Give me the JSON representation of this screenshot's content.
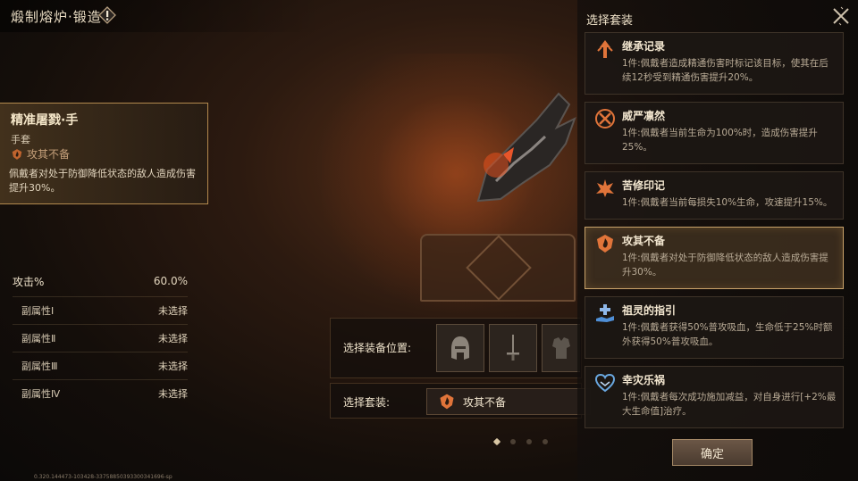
{
  "header": {
    "title": "煅制熔炉·锻造"
  },
  "item": {
    "name": "精准屠戮·手",
    "type": "手套",
    "set_name": "攻其不备",
    "description": "佩戴者对处于防御降低状态的敌人造成伤害提升30%。"
  },
  "stats": {
    "main": {
      "label": "攻击%",
      "value": "60.0%"
    },
    "subs": [
      {
        "label": "副属性Ⅰ",
        "value": "未选择"
      },
      {
        "label": "副属性Ⅱ",
        "value": "未选择"
      },
      {
        "label": "副属性Ⅲ",
        "value": "未选择"
      },
      {
        "label": "副属性Ⅳ",
        "value": "未选择"
      }
    ]
  },
  "selectors": {
    "slot_label": "选择装备位置:",
    "set_label": "选择套装:",
    "selected_set": "攻其不备",
    "slots": [
      "helmet-icon",
      "sword-icon",
      "armor-icon"
    ]
  },
  "pagination": {
    "total": 4,
    "active": 0
  },
  "panel": {
    "title": "选择套装",
    "confirm_label": "确定",
    "sets": [
      {
        "name": "继承记录",
        "desc": "1件:佩戴者造成精通伤害时标记该目标，使其在后续12秒受到精通伤害提升20%。",
        "icon": "arrow-up-icon",
        "color": "#e0743a"
      },
      {
        "name": "威严凛然",
        "desc": "1件:佩戴者当前生命为100%时，造成伤害提升25%。",
        "icon": "crossed-swords-icon",
        "color": "#e0743a"
      },
      {
        "name": "苦修印记",
        "desc": "1件:佩戴者当前每损失10%生命，攻速提升15%。",
        "icon": "spiked-crest-icon",
        "color": "#e0743a"
      },
      {
        "name": "攻其不备",
        "desc": "1件:佩戴者对处于防御降低状态的敌人造成伤害提升30%。",
        "icon": "flame-shield-icon",
        "color": "#e0743a"
      },
      {
        "name": "祖灵的指引",
        "desc": "1件:佩戴者获得50%普攻吸血，生命低于25%时额外获得50%普攻吸血。",
        "icon": "healing-hand-icon",
        "color": "#4f8fd6"
      },
      {
        "name": "幸灾乐祸",
        "desc": "1件:佩戴者每次成功施加减益，对自身进行[+2%最大生命值]治疗。",
        "icon": "heart-hands-icon",
        "color": "#6aa8e0"
      }
    ],
    "selected_index": 3
  },
  "footer": {
    "version": "0.320.144473-103428-33758850393300341696-sp"
  }
}
